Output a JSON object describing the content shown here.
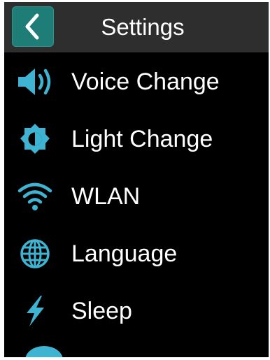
{
  "header": {
    "title": "Settings",
    "back_icon": "chevron-left-icon",
    "back_color": "#1f7d78"
  },
  "accent_color": "#3fb4d2",
  "menu": {
    "items": [
      {
        "label": "Voice Change",
        "icon": "speaker-volume-icon"
      },
      {
        "label": "Light Change",
        "icon": "brightness-icon"
      },
      {
        "label": "WLAN",
        "icon": "wifi-icon"
      },
      {
        "label": "Language",
        "icon": "globe-icon"
      },
      {
        "label": "Sleep",
        "icon": "lightning-icon"
      }
    ]
  }
}
